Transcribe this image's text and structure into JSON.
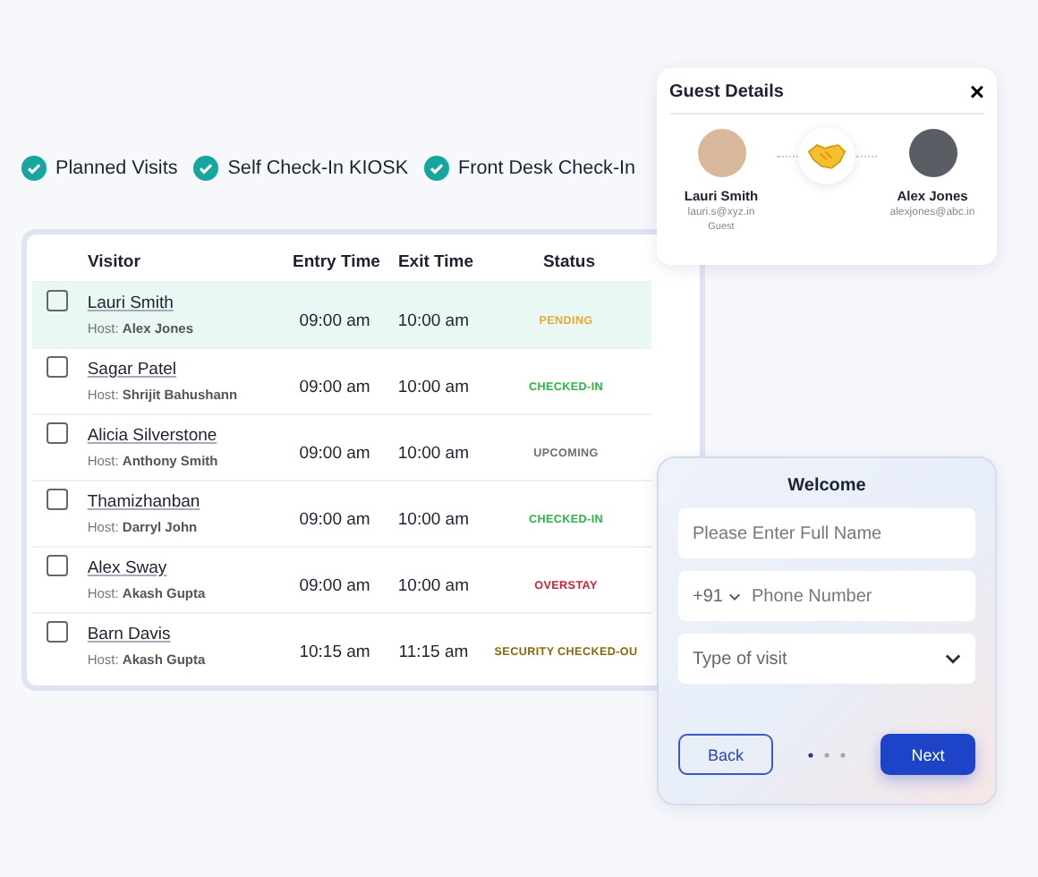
{
  "features": [
    {
      "label": "Planned Visits",
      "checked": true
    },
    {
      "label": "Self Check-In KIOSK",
      "checked": true
    },
    {
      "label": "Front Desk Check-In",
      "checked": true
    }
  ],
  "table": {
    "columns": [
      "Visitor",
      "Entry Time",
      "Exit Time",
      "Status"
    ],
    "rows": [
      {
        "visitor": "Lauri Smith",
        "host_label": "Host:",
        "host": "Alex Jones",
        "entry": "09:00 am",
        "exit": "10:00 am",
        "status": "PENDING",
        "color": "#e8a93a",
        "selected": true,
        "checked": false
      },
      {
        "visitor": "Sagar Patel",
        "host_label": "Host:",
        "host": "Shrijit Bahushann",
        "entry": "09:00 am",
        "exit": "10:00 am",
        "status": "CHECKED-IN",
        "color": "#2fb34a",
        "selected": false,
        "checked": false
      },
      {
        "visitor": "Alicia Silverstone",
        "host_label": "Host:",
        "host": "Anthony Smith",
        "entry": "09:00 am",
        "exit": "10:00 am",
        "status": "UPCOMING",
        "color": "#6b6f78",
        "selected": false,
        "checked": false
      },
      {
        "visitor": "Thamizhanban",
        "host_label": "Host:",
        "host": "Darryl John",
        "entry": "09:00 am",
        "exit": "10:00 am",
        "status": "CHECKED-IN",
        "color": "#2fb34a",
        "selected": false,
        "checked": false
      },
      {
        "visitor": "Alex Sway",
        "host_label": "Host:",
        "host": "Akash Gupta",
        "entry": "09:00 am",
        "exit": "10:00 am",
        "status": "OVERSTAY",
        "color": "#d0223a",
        "selected": false,
        "checked": false
      },
      {
        "visitor": "Barn Davis",
        "host_label": "Host:",
        "host": "Akash Gupta",
        "entry": "10:15 am",
        "exit": "11:15 am",
        "status": "SECURITY CHECKED-OU",
        "color": "#8a6a10",
        "selected": false,
        "checked": false
      }
    ]
  },
  "guest_details": {
    "title": "Guest Details",
    "close": "×",
    "guest": {
      "name": "Lauri Smith",
      "email": "lauri.s@xyz.in",
      "role": "Guest"
    },
    "host": {
      "name": "Alex Jones",
      "email": "alexjones@abc.in"
    }
  },
  "welcome": {
    "title": "Welcome",
    "name_placeholder": "Please Enter Full Name",
    "country_code": "+91",
    "phone_placeholder": "Phone Number",
    "visit_placeholder": "Type of visit",
    "back": "Back",
    "next": "Next"
  }
}
